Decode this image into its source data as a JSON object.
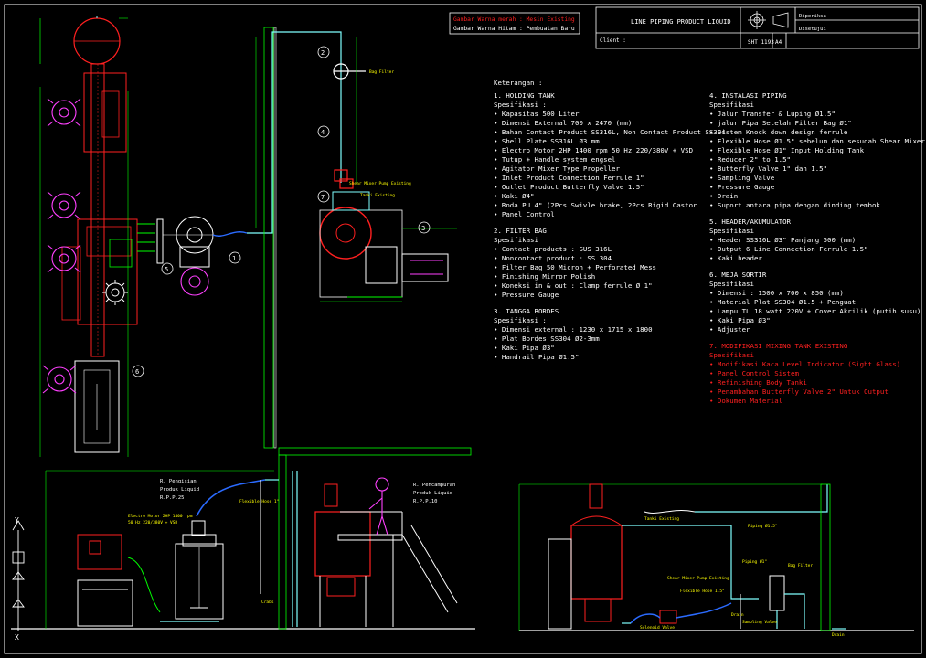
{
  "title_block": {
    "drawing_title": "LINE PIPING PRODUCT LIQUID",
    "client_label": "Client :",
    "diperiksa": "Diperiksa",
    "disetujui": "Disetujui",
    "sheet_no": "SHT 1193",
    "paper_size": "A4"
  },
  "legend": {
    "red_line": "Gambar Warna merah : Mesin Existing",
    "white_line": "Gambar Warna Hitam : Pembuatan Baru"
  },
  "notes": {
    "heading": "Keterangan :",
    "left": [
      {
        "title": "1. HOLDING TANK",
        "sub": "Spesifikasi :",
        "items": [
          "Kapasitas 500 Liter",
          "Dimensi External 700 x 2470 (mm)",
          "Bahan Contact Product SS316L, Non Contact Product SS304",
          "Shell Plate SS316L Ø3 mm",
          "Electro Motor 2HP 1400 rpm 50 Hz 220/380V + VSD",
          "Tutup + Handle system engsel",
          "Agitator Mixer Type Propeller",
          "Inlet Product Connection Ferrule 1\"",
          "Outlet Product Butterfly Valve 1.5\"",
          "Kaki Ø4\"",
          "Roda PU 4\" (2Pcs Swivle brake, 2Pcs Rigid Castor",
          "Panel Control"
        ]
      },
      {
        "title": "2. FILTER BAG",
        "sub": "Spesifikasi",
        "items": [
          "Contact products : SUS 316L",
          "Noncontact product : SS 304",
          "Filter Bag 50 Micron + Perforated Mess",
          "Finishing Mirror Polish",
          "Koneksi in & out : Clamp ferrule Ø 1\"",
          "Pressure Gauge"
        ]
      },
      {
        "title": "3. TANGGA BORDES",
        "sub": "Spesifikasi :",
        "items": [
          "Dimensi external : 1230 x 1715 x 1800",
          "Plat Bordes SS304 Ø2-3mm",
          "Kaki Pipa Ø3\"",
          "Handrail Pipa Ø1.5\""
        ]
      }
    ],
    "right": [
      {
        "title": "4. INSTALASI PIPING",
        "sub": "Spesifikasi",
        "red": false,
        "items": [
          "Jalur Transfer & Luping Ø1.5\"",
          "jalur Pipa Setelah Filter Bag Ø1\"",
          "Sistem Knock down design ferrule",
          "Flexible Hose Ø1.5\" sebelum dan sesudah Shear Mixer",
          "Flexible Hose Ø1\" Input Holding Tank",
          "Reducer 2\" to 1.5\"",
          "Butterfly Valve 1\" dan 1.5\"",
          "Sampling Valve",
          "Pressure Gauge",
          "Drain",
          "Suport antara pipa dengan dinding tembok"
        ]
      },
      {
        "title": "5. HEADER/AKUMULATOR",
        "sub": "Spesifikasi",
        "red": false,
        "items": [
          "Header SS316L Ø3\" Panjang 500 (mm)",
          "Output 6 Line Connection Ferrule 1.5\"",
          "Kaki header"
        ]
      },
      {
        "title": "6. MEJA SORTIR",
        "sub": "Spesifikasi",
        "red": false,
        "items": [
          "Dimensi : 1500 x 700 x 850 (mm)",
          "Material Plat SS304 Ø1.5 + Penguat",
          "Lampu TL 18 watt 220V + Cover Akrilik (putih susu)",
          "Kaki Pipa Ø3\"",
          "Adjuster"
        ]
      },
      {
        "title": "7. MODIFIKASI MIXING TANK EXISTING",
        "sub": "Spesifikasi",
        "red": true,
        "items": [
          "Modifikasi Kaca Level Indicator (Sight Glass)",
          "Panel Control Sistem",
          "Refinishing Body Tanki",
          "Penambahan Butterfly Valve 2\" Untuk Output",
          "Dokumen Material"
        ]
      }
    ]
  },
  "labels": {
    "bag_filter": "Bag Filter",
    "shear_mixer": "Shear Mixer Pump Existing",
    "tank_existing": "Tanki Existing",
    "room_fill_1": "R. Pengisian",
    "room_fill_2": "Produk Liquid",
    "room_fill_3": "R.P.P.25",
    "room_mix_1": "R. Pencampuran",
    "room_mix_2": "Produk Liquid",
    "room_mix_3": "R.P.P.10",
    "flexible_hose_1": "Flexible Hose 1\"",
    "electro_motor_1": "Electro Motor 2HP 1400 rpm",
    "electro_motor_2": "50 Hz 220/380V + VSD",
    "crabs": "Crabs",
    "tank_existing_2": "Tanki Existing",
    "piping_15": "Piping Ø1.5\"",
    "piping_1": "Piping Ø1\"",
    "bag_filter_2": "Bag Filter",
    "shear_mixer_2": "Shear Mixer Pump Existing",
    "flexible_hose_15": "Flexible Hose 1.5\"",
    "drain": "Drain",
    "sampling_valve": "Sampling Valve",
    "solenoid_valve": "Solenoid Valve",
    "drain_2": "Drain",
    "axis_y": "Y",
    "axis_x": "X"
  },
  "callouts": [
    "1",
    "2",
    "3",
    "4",
    "5",
    "6",
    "7"
  ],
  "colors": {
    "green": "#00ff00",
    "cyan": "#7fffff",
    "red": "#ff2020",
    "yellow": "#ffff00",
    "magenta": "#ff40ff",
    "blue": "#2b6bff",
    "orange": "#ff8c00",
    "white": "#ffffff"
  }
}
